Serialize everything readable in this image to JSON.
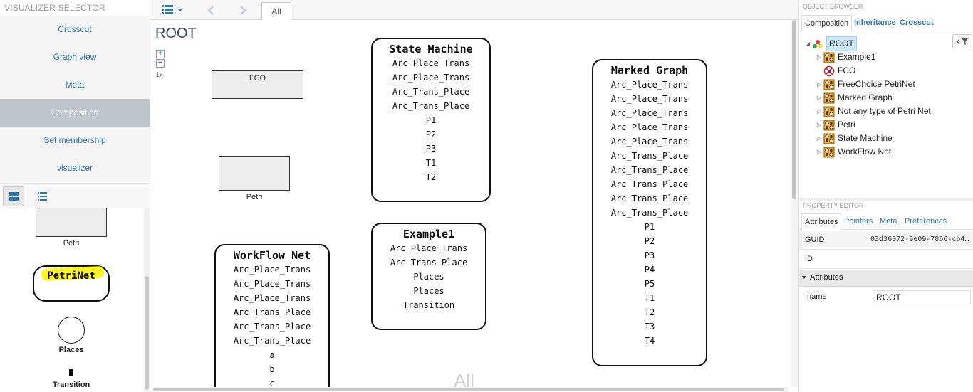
{
  "left": {
    "title": "VISUALIZER SELECTOR",
    "visualizers": [
      {
        "label": "Crosscut",
        "active": false
      },
      {
        "label": "Graph view",
        "active": false
      },
      {
        "label": "Meta",
        "active": false
      },
      {
        "label": "Composition",
        "active": true
      },
      {
        "label": "Set membership",
        "active": false
      },
      {
        "label": "visualizer",
        "active": false
      }
    ],
    "palette": {
      "petri_label": "Petri",
      "petrinet_label": "PetriNet",
      "places_label": "Places",
      "transition_label": "Transition"
    }
  },
  "center": {
    "tab_label": "All",
    "root_title": "ROOT",
    "zoom_in": "+",
    "zoom_out": "−",
    "zoom_level": "1x",
    "fco_label": "FCO",
    "petri_label": "Petri",
    "watermark": "All",
    "state_machine": {
      "title": "State Machine",
      "rows": [
        "Arc_Place_Trans",
        "Arc_Place_Trans",
        "Arc_Trans_Place",
        "Arc_Trans_Place",
        "P1",
        "P2",
        "P3",
        "T1",
        "T2"
      ]
    },
    "example1": {
      "title": "Example1",
      "rows": [
        "Arc_Place_Trans",
        "Arc_Trans_Place",
        "Places",
        "Places",
        "Transition"
      ]
    },
    "marked_graph": {
      "title": "Marked Graph",
      "rows": [
        "Arc_Place_Trans",
        "Arc_Place_Trans",
        "Arc_Place_Trans",
        "Arc_Place_Trans",
        "Arc_Place_Trans",
        "Arc_Trans_Place",
        "Arc_Trans_Place",
        "Arc_Trans_Place",
        "Arc_Trans_Place",
        "Arc_Trans_Place",
        "P1",
        "P2",
        "P3",
        "P4",
        "P5",
        "T1",
        "T2",
        "T3",
        "T4"
      ]
    },
    "workflow_net": {
      "title": "WorkFlow Net",
      "rows": [
        "Arc_Place_Trans",
        "Arc_Place_Trans",
        "Arc_Place_Trans",
        "Arc_Trans_Place",
        "Arc_Trans_Place",
        "Arc_Trans_Place",
        "a",
        "b",
        "c"
      ]
    }
  },
  "right": {
    "object_browser_title": "OBJECT BROWSER",
    "tabs": [
      "Composition",
      "Inheritance",
      "Crosscut"
    ],
    "tree": [
      {
        "label": "ROOT",
        "level": 0,
        "expanded": true,
        "selected": true,
        "icon": "root-icon"
      },
      {
        "label": "Example1",
        "level": 1,
        "icon": "model-icon"
      },
      {
        "label": "FCO",
        "level": 1,
        "icon": "fco-icon"
      },
      {
        "label": "FreeChoice PetriNet",
        "level": 1,
        "icon": "model-icon"
      },
      {
        "label": "Marked Graph",
        "level": 1,
        "icon": "model-icon"
      },
      {
        "label": "Not any type of Petri Net",
        "level": 1,
        "icon": "model-icon"
      },
      {
        "label": "Petri",
        "level": 1,
        "icon": "model-icon"
      },
      {
        "label": "State Machine",
        "level": 1,
        "icon": "model-icon"
      },
      {
        "label": "WorkFlow Net",
        "level": 1,
        "icon": "model-icon"
      }
    ],
    "property_editor_title": "PROPERTY EDITOR",
    "prop_tabs": [
      "Attributes",
      "Pointers",
      "Meta",
      "Preferences"
    ],
    "guid_key": "GUID",
    "guid_value": "03d36072-9e09-7866-cb4…",
    "id_key": "ID",
    "attributes_group": "Attributes",
    "name_key": "name",
    "name_value": "ROOT"
  }
}
